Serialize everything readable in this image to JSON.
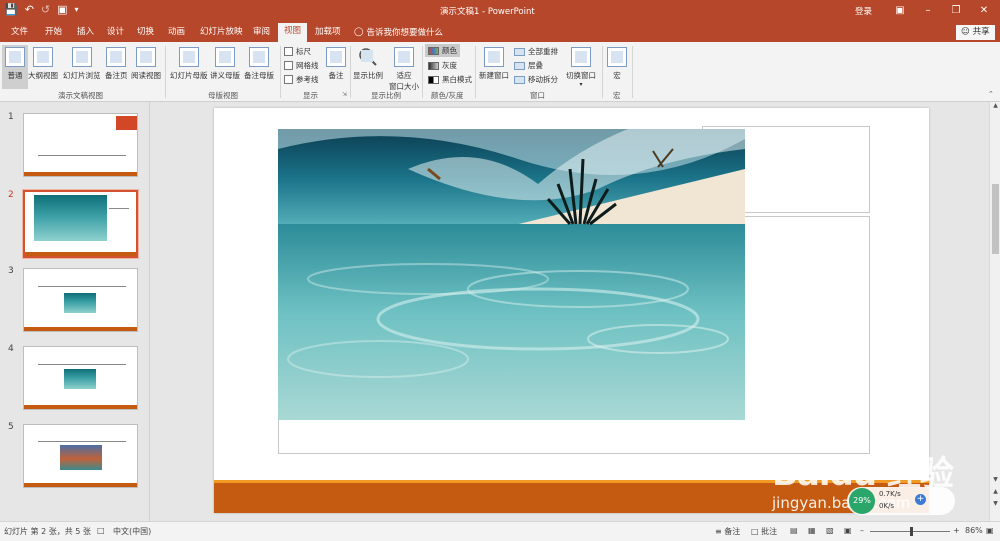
{
  "titlebar": {
    "title": "演示文稿1  -  PowerPoint",
    "login": "登录",
    "qat": [
      "save-icon",
      "undo-icon",
      "redo-icon",
      "present-icon",
      "customize-icon"
    ]
  },
  "tabs": [
    "文件",
    "开始",
    "插入",
    "设计",
    "切换",
    "动画",
    "幻灯片放映",
    "审阅",
    "视图",
    "加载项"
  ],
  "active_tab": "视图",
  "tell_me": "告诉我你想要做什么",
  "share": "共享",
  "ribbon": {
    "presentation_views": {
      "label": "演示文稿视图",
      "buttons": [
        "普通",
        "大纲视图",
        "幻灯片浏览",
        "备注页",
        "阅读视图"
      ]
    },
    "master_views": {
      "label": "母版视图",
      "buttons": [
        "幻灯片母版",
        "讲义母版",
        "备注母版"
      ]
    },
    "show": {
      "label": "显示",
      "checks": [
        "标尺",
        "网格线",
        "参考线"
      ],
      "notes": "备注"
    },
    "zoom": {
      "label": "显示比例",
      "zoom": "显示比例",
      "fit_line1": "适应",
      "fit_line2": "窗口大小"
    },
    "color": {
      "label": "颜色/灰度",
      "options": [
        "颜色",
        "灰度",
        "黑白模式"
      ]
    },
    "window": {
      "label": "窗口",
      "new_window": "新建窗口",
      "arrange_all": "全部重排",
      "cascade": "层叠",
      "move_split": "移动拆分",
      "switch_windows": "切换窗口"
    },
    "macros": {
      "label": "宏",
      "button": "宏"
    }
  },
  "slides": [
    "1",
    "2",
    "3",
    "4",
    "5"
  ],
  "current_slide": 2,
  "status": {
    "slide_info": "幻灯片 第 2 张，共 5 张",
    "language": "中文(中国)",
    "notes": "备注",
    "comments": "批注",
    "zoom": "86%"
  },
  "overlay": {
    "watermark": "Baidu 经验",
    "url": "jingyan.baidu.com",
    "speed_pct": "29%",
    "up": "0.7K/s",
    "down": "0K/s"
  }
}
